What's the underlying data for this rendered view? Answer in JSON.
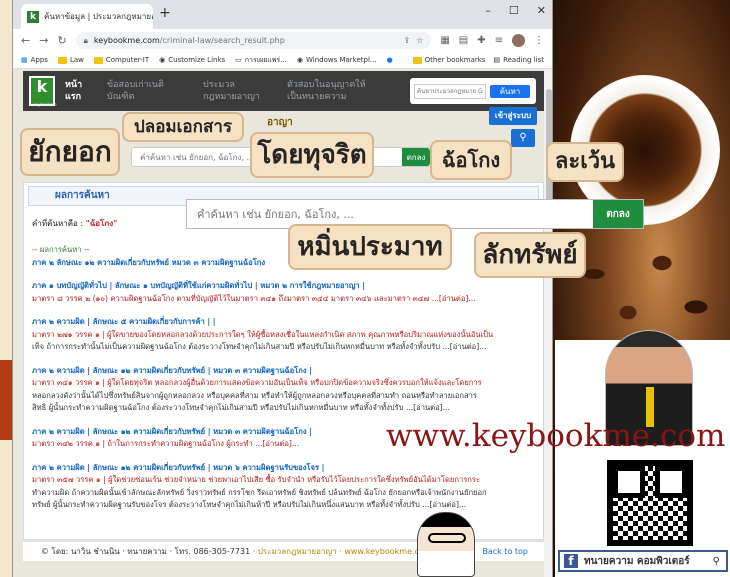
{
  "browser": {
    "tab_title": "ค้นหาข้อมูล | ประมวลกฎหมายอาญา |",
    "url_domain": "keybookme.com",
    "url_path": "/criminal-law/search_result.php",
    "bookmarks": [
      "Apps",
      "Law",
      "Computer-IT",
      "Customize Links",
      "การเผยแพร่...",
      "Windows Marketpl...",
      "Other bookmarks",
      "Reading list"
    ]
  },
  "site": {
    "logo": "k",
    "logo_sub": "keybookme",
    "nav": [
      "หน้าแรก",
      "ข้อสอบเก่าเนติบัณฑิต",
      "ประมวลกฎหมายอาญา",
      "ตัวสอบในอนุญาตให้เป็นทนายความ"
    ],
    "search_placeholder": "ค้นหาประมวลกฎหมาย Go",
    "search_button": "ค้นหา",
    "login_button": "เข้าสู่ระบบ",
    "search_icon": "magnifier-icon",
    "title": "อาญา",
    "inner_search_placeholder": "คำค้นหา เช่น ยักยอก, ฉ้อโกง, ...",
    "inner_search_button": "ตกลง"
  },
  "results": {
    "header": "ผลการค้นหา",
    "keyword_label": "คำที่ค้นหาคือ :",
    "keyword": "\"ฉ้อโกง\"",
    "section_title": "-- ผลการค้นหา --",
    "items": [
      {
        "path": "ภาค ๒ ลักษณะ ๑๒ ความผิดเกี่ยวกับทรัพย์ หมวด ๓ ความผิดฐานฉ้อโกง",
        "lines": []
      },
      {
        "path": "ภาค ๑ บทบัญญัติทั่วไป | ลักษณะ ๑ บทบัญญัติที่ใช้แก่ความผิดทั่วไป | หมวด ๒ การใช้กฎหมายอาญา |",
        "lines": [
          "มาตรา ๘ วรรค ๒ (๑๐) ความผิดฐานฉ้อโกง ตามที่บัญญัติไว้ในมาตรา ๓๔๑ ถึงมาตรา ๓๔๔ มาตรา ๓๔๖ และมาตรา ๓๔๗ ...[อ่านต่อ]..."
        ]
      },
      {
        "path": "ภาค ๒ ความผิด | ลักษณะ ๕ ความผิดเกี่ยวกับการค้า | |",
        "lines": [
          "มาตรา ๒๗๑ วรรค ๑ | ผู้ใดขายของโดยหลอกลวงด้วยประการใดๆ ให้ผู้ซื้อหลงเชื่อในแหล่งกำเนิด สภาพ คุณภาพหรือปริมาณแห่งของนั้นอันเป็น",
          "เท็จ ถ้าการกระทำนั้นไม่เป็นความผิดฐานฉ้อโกง ต้องระวางโทษจำคุกไม่เกินสามปี หรือปรับไม่เกินหกหมื่นบาท หรือทั้งจำทั้งปรับ ...[อ่านต่อ]..."
        ]
      },
      {
        "path": "ภาค ๒ ความผิด | ลักษณะ ๑๒ ความผิดเกี่ยวกับทรัพย์ | หมวด ๓ ความผิดฐานฉ้อโกง |",
        "lines": [
          "มาตรา ๓๔๑ วรรค ๑ | ผู้ใดโดยทุจริต หลอกลวงผู้อื่นด้วยการแสดงข้อความอันเป็นเท็จ หรือปกปิดข้อความจริงซึ่งควรบอกให้แจ้งและโดยการ",
          "หลอกลวงดังว่านั้นได้ไปซึ่งทรัพย์สินจากผู้ถูกหลอกลวง หรือบุคคลที่สาม หรือทำให้ผู้ถูกหลอกลวงหรือบุคคลที่สามทำ ถอนหรือทำลายเอกสาร",
          "สิทธิ ผู้นั้นกระทำความผิดฐานฉ้อโกง ต้องระวางโทษจำคุกไม่เกินสามปี หรือปรับไม่เกินหกหมื่นบาท หรือทั้งจำทั้งปรับ ...[อ่านต่อ]..."
        ]
      },
      {
        "path": "ภาค ๒ ความผิด | ลักษณะ ๑๒ ความผิดเกี่ยวกับทรัพย์ | หมวด ๓ ความผิดฐานฉ้อโกง |",
        "lines": [
          "มาตรา ๓๔๒ วรรค ๑ | ถ้าในการกระทำความผิดฐานฉ้อโกง ผู้กระทำ ...[อ่านต่อ]..."
        ]
      },
      {
        "path": "ภาค ๒ ความผิด | ลักษณะ ๑๒ ความผิดเกี่ยวกับทรัพย์ | หมวด ๖ ความผิดฐานรับของโจร |",
        "lines": [
          "มาตรา ๓๕๗ วรรค ๑ | ผู้ใดช่วยซ่อนเร้น ช่วยจำหน่าย ช่วยพาเอาไปเสีย ซื้อ รับจำนำ หรือรับไว้โดยประการใดซึ่งทรัพย์อันได้มาโดยการกระ",
          "ทำความผิด ถ้าความผิดนั้นเข้าลักษณะลักทรัพย์ วิ่งราวทรัพย์ กรรโชก รีดเอาทรัพย์ ชิงทรัพย์ ปล้นทรัพย์ ฉ้อโกง ยักยอกหรือเจ้าพนักงานยักยอก",
          "ทรัพย์ ผู้นั้นกระทำความผิดฐานรับของโจร ต้องระวางโทษจำคุกไม่เกินห้าปี หรือปรับไม่เกินหนึ่งแสนบาท หรือทั้งจำทั้งปรับ ...[อ่านต่อ]..."
        ]
      }
    ]
  },
  "footer": {
    "credit": "© โดย: นาวิน ชำนนิน · ทนายความ · โทร. 086-305-7731 ·",
    "brand": "ประมวลกฎหมายอาญา · www.keybookme.com",
    "back_to_top": "Back to top"
  },
  "overlay": {
    "tags": [
      "ยักยอก",
      "ปลอมเอกสาร",
      "โดยทุจริต",
      "ฉ้อโกง",
      "ละเว้น",
      "หมิ่นประมาท",
      "ลักทรัพย์"
    ],
    "search_placeholder": "คำค้นหา เช่น ยักยอก, ฉ้อโกง, ...",
    "search_button": "ตกลง",
    "watermark": "www.keybookme.com",
    "fb_label": "ทนายความ คอมพิวเตอร์"
  }
}
